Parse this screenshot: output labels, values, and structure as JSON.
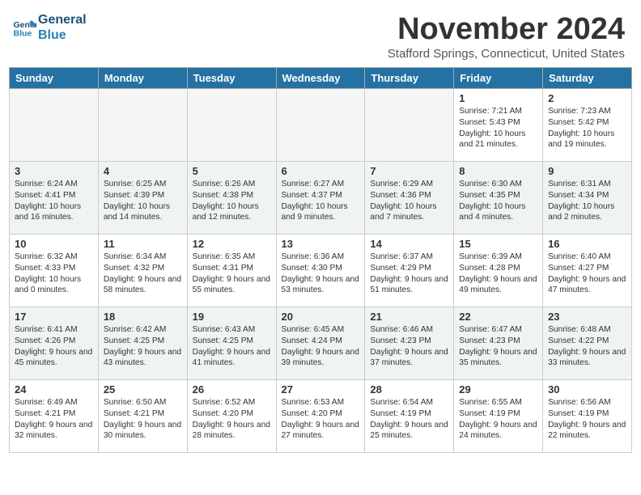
{
  "logo": {
    "line1": "General",
    "line2": "Blue"
  },
  "title": "November 2024",
  "location": "Stafford Springs, Connecticut, United States",
  "days_of_week": [
    "Sunday",
    "Monday",
    "Tuesday",
    "Wednesday",
    "Thursday",
    "Friday",
    "Saturday"
  ],
  "weeks": [
    {
      "shaded": false,
      "days": [
        {
          "num": "",
          "empty": true,
          "info": ""
        },
        {
          "num": "",
          "empty": true,
          "info": ""
        },
        {
          "num": "",
          "empty": true,
          "info": ""
        },
        {
          "num": "",
          "empty": true,
          "info": ""
        },
        {
          "num": "",
          "empty": true,
          "info": ""
        },
        {
          "num": "1",
          "empty": false,
          "info": "Sunrise: 7:21 AM\nSunset: 5:43 PM\nDaylight: 10 hours and 21 minutes."
        },
        {
          "num": "2",
          "empty": false,
          "info": "Sunrise: 7:23 AM\nSunset: 5:42 PM\nDaylight: 10 hours and 19 minutes."
        }
      ]
    },
    {
      "shaded": true,
      "days": [
        {
          "num": "3",
          "empty": false,
          "info": "Sunrise: 6:24 AM\nSunset: 4:41 PM\nDaylight: 10 hours and 16 minutes."
        },
        {
          "num": "4",
          "empty": false,
          "info": "Sunrise: 6:25 AM\nSunset: 4:39 PM\nDaylight: 10 hours and 14 minutes."
        },
        {
          "num": "5",
          "empty": false,
          "info": "Sunrise: 6:26 AM\nSunset: 4:38 PM\nDaylight: 10 hours and 12 minutes."
        },
        {
          "num": "6",
          "empty": false,
          "info": "Sunrise: 6:27 AM\nSunset: 4:37 PM\nDaylight: 10 hours and 9 minutes."
        },
        {
          "num": "7",
          "empty": false,
          "info": "Sunrise: 6:29 AM\nSunset: 4:36 PM\nDaylight: 10 hours and 7 minutes."
        },
        {
          "num": "8",
          "empty": false,
          "info": "Sunrise: 6:30 AM\nSunset: 4:35 PM\nDaylight: 10 hours and 4 minutes."
        },
        {
          "num": "9",
          "empty": false,
          "info": "Sunrise: 6:31 AM\nSunset: 4:34 PM\nDaylight: 10 hours and 2 minutes."
        }
      ]
    },
    {
      "shaded": false,
      "days": [
        {
          "num": "10",
          "empty": false,
          "info": "Sunrise: 6:32 AM\nSunset: 4:33 PM\nDaylight: 10 hours and 0 minutes."
        },
        {
          "num": "11",
          "empty": false,
          "info": "Sunrise: 6:34 AM\nSunset: 4:32 PM\nDaylight: 9 hours and 58 minutes."
        },
        {
          "num": "12",
          "empty": false,
          "info": "Sunrise: 6:35 AM\nSunset: 4:31 PM\nDaylight: 9 hours and 55 minutes."
        },
        {
          "num": "13",
          "empty": false,
          "info": "Sunrise: 6:36 AM\nSunset: 4:30 PM\nDaylight: 9 hours and 53 minutes."
        },
        {
          "num": "14",
          "empty": false,
          "info": "Sunrise: 6:37 AM\nSunset: 4:29 PM\nDaylight: 9 hours and 51 minutes."
        },
        {
          "num": "15",
          "empty": false,
          "info": "Sunrise: 6:39 AM\nSunset: 4:28 PM\nDaylight: 9 hours and 49 minutes."
        },
        {
          "num": "16",
          "empty": false,
          "info": "Sunrise: 6:40 AM\nSunset: 4:27 PM\nDaylight: 9 hours and 47 minutes."
        }
      ]
    },
    {
      "shaded": true,
      "days": [
        {
          "num": "17",
          "empty": false,
          "info": "Sunrise: 6:41 AM\nSunset: 4:26 PM\nDaylight: 9 hours and 45 minutes."
        },
        {
          "num": "18",
          "empty": false,
          "info": "Sunrise: 6:42 AM\nSunset: 4:25 PM\nDaylight: 9 hours and 43 minutes."
        },
        {
          "num": "19",
          "empty": false,
          "info": "Sunrise: 6:43 AM\nSunset: 4:25 PM\nDaylight: 9 hours and 41 minutes."
        },
        {
          "num": "20",
          "empty": false,
          "info": "Sunrise: 6:45 AM\nSunset: 4:24 PM\nDaylight: 9 hours and 39 minutes."
        },
        {
          "num": "21",
          "empty": false,
          "info": "Sunrise: 6:46 AM\nSunset: 4:23 PM\nDaylight: 9 hours and 37 minutes."
        },
        {
          "num": "22",
          "empty": false,
          "info": "Sunrise: 6:47 AM\nSunset: 4:23 PM\nDaylight: 9 hours and 35 minutes."
        },
        {
          "num": "23",
          "empty": false,
          "info": "Sunrise: 6:48 AM\nSunset: 4:22 PM\nDaylight: 9 hours and 33 minutes."
        }
      ]
    },
    {
      "shaded": false,
      "days": [
        {
          "num": "24",
          "empty": false,
          "info": "Sunrise: 6:49 AM\nSunset: 4:21 PM\nDaylight: 9 hours and 32 minutes."
        },
        {
          "num": "25",
          "empty": false,
          "info": "Sunrise: 6:50 AM\nSunset: 4:21 PM\nDaylight: 9 hours and 30 minutes."
        },
        {
          "num": "26",
          "empty": false,
          "info": "Sunrise: 6:52 AM\nSunset: 4:20 PM\nDaylight: 9 hours and 28 minutes."
        },
        {
          "num": "27",
          "empty": false,
          "info": "Sunrise: 6:53 AM\nSunset: 4:20 PM\nDaylight: 9 hours and 27 minutes."
        },
        {
          "num": "28",
          "empty": false,
          "info": "Sunrise: 6:54 AM\nSunset: 4:19 PM\nDaylight: 9 hours and 25 minutes."
        },
        {
          "num": "29",
          "empty": false,
          "info": "Sunrise: 6:55 AM\nSunset: 4:19 PM\nDaylight: 9 hours and 24 minutes."
        },
        {
          "num": "30",
          "empty": false,
          "info": "Sunrise: 6:56 AM\nSunset: 4:19 PM\nDaylight: 9 hours and 22 minutes."
        }
      ]
    }
  ]
}
